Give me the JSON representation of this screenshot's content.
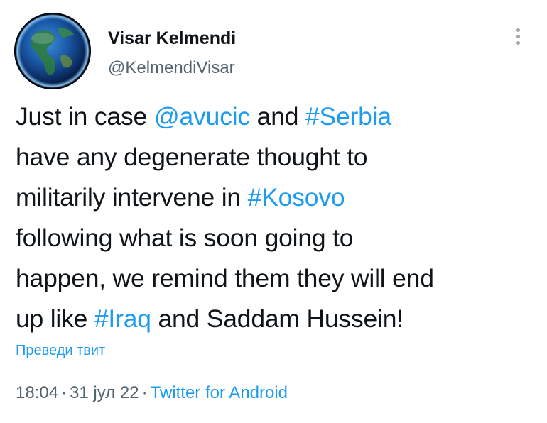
{
  "user": {
    "display_name": "Visar Kelmendi",
    "handle": "@KelmendiVisar"
  },
  "tweet": {
    "lines": [
      [
        {
          "text": "Just in case ",
          "link": false
        },
        {
          "text": "@avucic",
          "link": true
        },
        {
          "text": " and ",
          "link": false
        },
        {
          "text": "#Serbia",
          "link": true
        }
      ],
      [
        {
          "text": "have any degenerate thought to",
          "link": false
        }
      ],
      [
        {
          "text": "militarily intervene in ",
          "link": false
        },
        {
          "text": "#Kosovo",
          "link": true
        }
      ],
      [
        {
          "text": "following what is soon going to",
          "link": false
        }
      ],
      [
        {
          "text": "happen, we remind them they will end",
          "link": false
        }
      ],
      [
        {
          "text": "up like ",
          "link": false
        },
        {
          "text": "#Iraq",
          "link": true
        },
        {
          "text": " and Saddam Hussein!",
          "link": false
        }
      ]
    ],
    "translate_label": "Преведи твит"
  },
  "meta": {
    "time": "18:04",
    "separator": "·",
    "date": "31 јул 22",
    "source": "Twitter for Android"
  },
  "icons": {
    "more": "more-vertical-icon",
    "avatar": "earth-globe-avatar"
  },
  "colors": {
    "link": "#1d9bf0",
    "secondary_text": "#536471",
    "primary_text": "#0f1419"
  }
}
